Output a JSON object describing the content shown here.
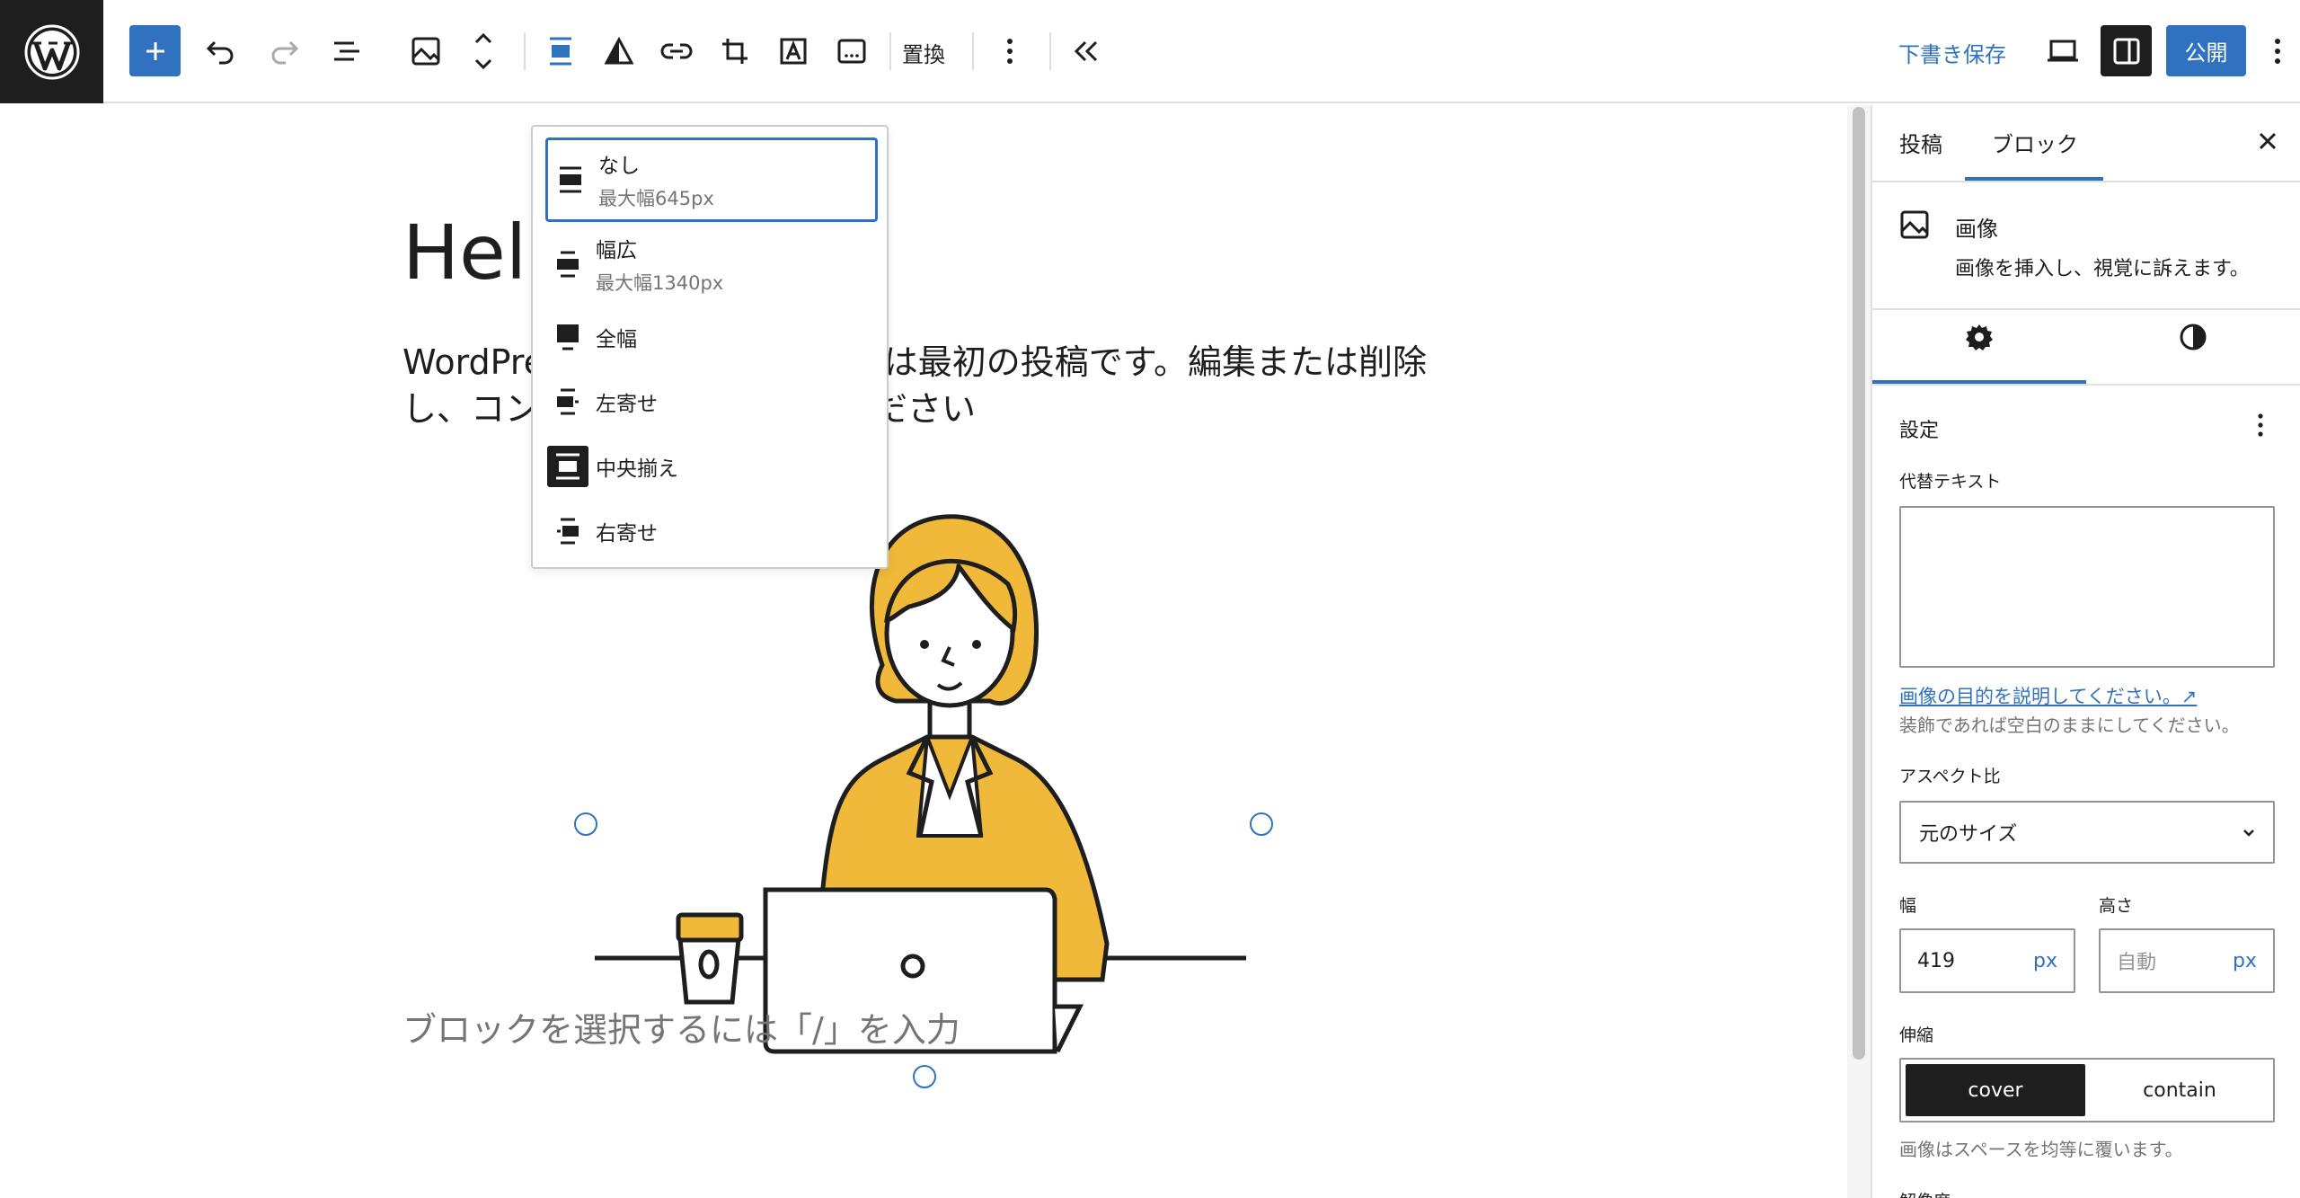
{
  "toolbar": {
    "replace_label": "置換",
    "draft_save_label": "下書き保存",
    "publish_label": "公開"
  },
  "editor": {
    "title": "Hello world!",
    "title_visible": "Hell",
    "paragraph_line1_left": "WordPre",
    "paragraph_line1_right": "は最初の投稿です。編集または削除",
    "paragraph_line2_left": "し、コン",
    "paragraph_line2_right": "ださい",
    "placeholder": "ブロックを選択するには「/」を入力"
  },
  "align_menu": {
    "items": [
      {
        "label": "なし",
        "sub": "最大幅645px",
        "selected": true
      },
      {
        "label": "幅広",
        "sub": "最大幅1340px"
      },
      {
        "label": "全幅",
        "sub": ""
      },
      {
        "label": "左寄せ",
        "sub": ""
      },
      {
        "label": "中央揃え",
        "sub": "",
        "active_icon": true
      },
      {
        "label": "右寄せ",
        "sub": ""
      }
    ]
  },
  "sidebar": {
    "tabs": [
      {
        "label": "投稿"
      },
      {
        "label": "ブロック",
        "active": true
      }
    ],
    "block_card": {
      "title": "画像",
      "description": "画像を挿入し、視覚に訴えます。"
    },
    "panel_title": "設定",
    "alt_label": "代替テキスト",
    "alt_value": "",
    "alt_help_link": "画像の目的を説明してください。↗",
    "alt_help_text": "装飾であれば空白のままにしてください。",
    "aspect_label": "アスペクト比",
    "aspect_value": "元のサイズ",
    "width_label": "幅",
    "width_value": "419",
    "width_unit": "px",
    "height_label": "高さ",
    "height_placeholder": "自動",
    "height_unit": "px",
    "scale_label": "伸縮",
    "scale_options": [
      "cover",
      "contain"
    ],
    "scale_help": "画像はスペースを均等に覆います。",
    "cut_label": "解像度"
  },
  "colors": {
    "accent": "#3072c0",
    "dark": "#1e1e1e",
    "illustration_yellow": "#f0b93a"
  }
}
